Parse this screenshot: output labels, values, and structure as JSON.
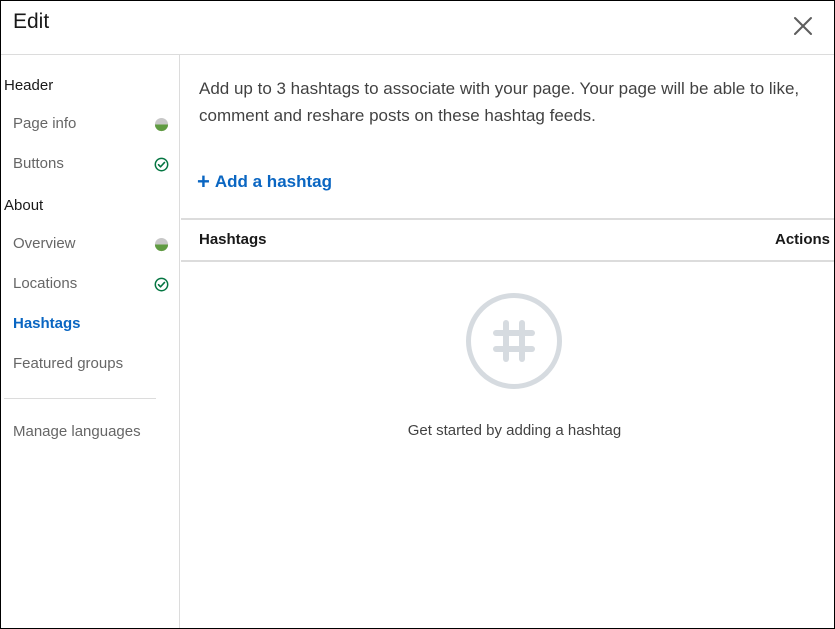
{
  "dialog": {
    "title": "Edit",
    "close_icon": "close-icon"
  },
  "sidebar": {
    "sections": [
      {
        "title": "Header",
        "items": [
          {
            "label": "Page info",
            "status": "partial"
          },
          {
            "label": "Buttons",
            "status": "complete"
          }
        ]
      },
      {
        "title": "About",
        "items": [
          {
            "label": "Overview",
            "status": "partial"
          },
          {
            "label": "Locations",
            "status": "complete"
          },
          {
            "label": "Hashtags",
            "status": "active"
          },
          {
            "label": "Featured groups",
            "status": "none"
          }
        ]
      }
    ],
    "manage_languages": "Manage languages"
  },
  "main": {
    "description": "Add up to 3 hashtags to associate with your page. Your page will be able to like, comment and reshare posts on these hashtag feeds.",
    "add_button": {
      "icon": "plus",
      "label": "Add a hashtag"
    },
    "table": {
      "columns": [
        "Hashtags",
        "Actions"
      ],
      "rows": []
    },
    "empty_state": {
      "icon": "hashtag-icon",
      "text": "Get started by adding a hashtag"
    }
  },
  "colors": {
    "accent": "#0a66c2",
    "complete": "#057642",
    "partial_top": "#c8c8c8",
    "partial_bottom": "#5f9b41",
    "divider": "#dcdcdc",
    "empty_icon": "#d6dbe0"
  }
}
